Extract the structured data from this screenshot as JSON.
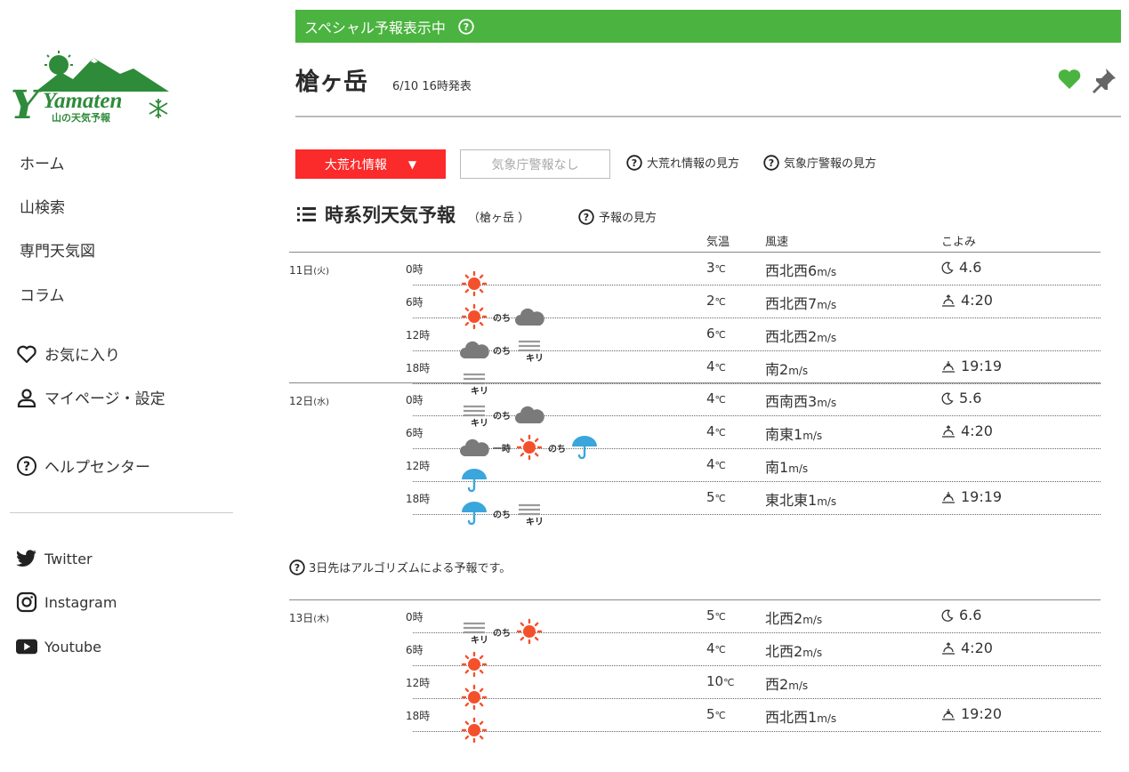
{
  "brand": {
    "logo_text": "Yamaten",
    "logo_sub": "山の天気予報"
  },
  "sidebar": {
    "items": [
      {
        "label": "ホーム"
      },
      {
        "label": "山検索"
      },
      {
        "label": "専門天気図"
      },
      {
        "label": "コラム"
      }
    ],
    "favorites": "お気に入り",
    "mypage": "マイページ・設定",
    "help": "ヘルプセンター",
    "social": [
      {
        "label": "Twitter",
        "icon": "twitter-icon"
      },
      {
        "label": "Instagram",
        "icon": "instagram-icon"
      },
      {
        "label": "Youtube",
        "icon": "youtube-icon"
      }
    ]
  },
  "banner": {
    "text": "スペシャル予報表示中"
  },
  "header": {
    "mountain": "槍ヶ岳",
    "issued": "6/10 16時発表"
  },
  "controls": {
    "storm_label": "大荒れ情報",
    "storm_arrow": "▼",
    "jma_label": "気象庁警報なし",
    "storm_help": "大荒れ情報の見方",
    "jma_help": "気象庁警報の見方"
  },
  "section": {
    "title": "時系列天気予報",
    "location": "（槍ヶ岳 ）",
    "help": "予報の見方"
  },
  "columns": {
    "temp": "気温",
    "wind": "風速",
    "calendar": "こよみ"
  },
  "labels": {
    "later": "のち",
    "temporary": "一時",
    "fog": "キリ",
    "temp_unit": "℃",
    "wind_unit": "m/s"
  },
  "days": [
    {
      "date": "11日",
      "weekday": "(火)",
      "rows": [
        {
          "time": "0時",
          "temp": "3",
          "wind": "西北西6",
          "cal": "4.6",
          "cal_icon": "moon"
        },
        {
          "time": "6時",
          "temp": "2",
          "wind": "西北西7",
          "cal": "4:20",
          "cal_icon": "sunrise"
        },
        {
          "time": "12時",
          "temp": "6",
          "wind": "西北西2",
          "cal": "",
          "cal_icon": ""
        },
        {
          "time": "18時",
          "temp": "4",
          "wind": "南2",
          "cal": "19:19",
          "cal_icon": "sunset"
        }
      ]
    },
    {
      "date": "12日",
      "weekday": "(水)",
      "rows": [
        {
          "time": "0時",
          "temp": "4",
          "wind": "西南西3",
          "cal": "5.6",
          "cal_icon": "moon"
        },
        {
          "time": "6時",
          "temp": "4",
          "wind": "南東1",
          "cal": "4:20",
          "cal_icon": "sunrise"
        },
        {
          "time": "12時",
          "temp": "4",
          "wind": "南1",
          "cal": "",
          "cal_icon": ""
        },
        {
          "time": "18時",
          "temp": "5",
          "wind": "東北東1",
          "cal": "19:19",
          "cal_icon": "sunset"
        }
      ]
    },
    {
      "date": "13日",
      "weekday": "(木)",
      "rows": [
        {
          "time": "0時",
          "temp": "5",
          "wind": "北西2",
          "cal": "6.6",
          "cal_icon": "moon"
        },
        {
          "time": "6時",
          "temp": "4",
          "wind": "北西2",
          "cal": "4:20",
          "cal_icon": "sunrise"
        },
        {
          "time": "12時",
          "temp": "10",
          "wind": "西2",
          "cal": "",
          "cal_icon": ""
        },
        {
          "time": "18時",
          "temp": "5",
          "wind": "西北西1",
          "cal": "19:20",
          "cal_icon": "sunset"
        }
      ]
    }
  ],
  "note": "3日先はアルゴリズムによる予報です。",
  "colors": {
    "accent_green": "#4bb33f",
    "alert_red": "#fb2b2b",
    "sun": "#f4502c",
    "cloud": "#7a7a7a",
    "rain": "#3aa6dc"
  }
}
